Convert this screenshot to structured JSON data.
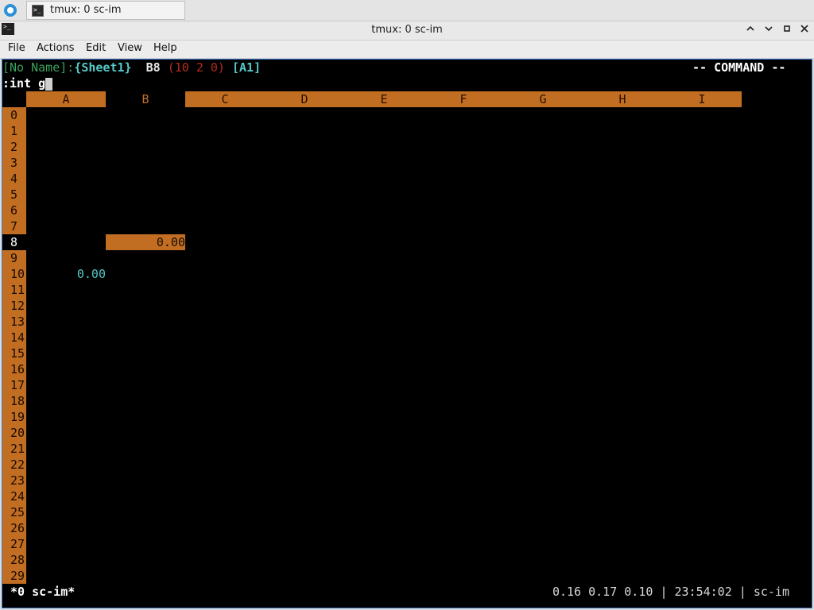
{
  "taskbar": {
    "task_label": "tmux: 0 sc-im"
  },
  "window": {
    "title": "tmux: 0 sc-im",
    "minimize": "^",
    "restore": "⌄",
    "maximize": "□",
    "close": "✕"
  },
  "menubar": {
    "items": [
      "File",
      "Actions",
      "Edit",
      "View",
      "Help"
    ]
  },
  "scim": {
    "header": {
      "file": "[No Name]",
      "colon": ":",
      "sheet": "{Sheet1}",
      "cell": "B8",
      "cell_info": "(10 2 0)",
      "cell_ref": "[A1]",
      "mode": "-- COMMAND --"
    },
    "command_line": ":int g",
    "columns": [
      "A",
      "B",
      "C",
      "D",
      "E",
      "F",
      "G",
      "H",
      "I"
    ],
    "rows": [
      "0",
      "1",
      "2",
      "3",
      "4",
      "5",
      "6",
      "7",
      "8",
      "9",
      "10",
      "11",
      "12",
      "13",
      "14",
      "15",
      "16",
      "17",
      "18",
      "19",
      "20",
      "21",
      "22",
      "23",
      "24",
      "25",
      "26",
      "27",
      "28",
      "29"
    ],
    "cells": {
      "b8": "0.00",
      "a10": "0.00"
    },
    "selected_row": "8",
    "selected_col": "B"
  },
  "tmux": {
    "window_label": "*0 sc-im*",
    "load": "0.16 0.17 0.10",
    "sep1": "|",
    "time": "23:54:02",
    "sep2": "|",
    "host": "sc-im"
  },
  "colors": {
    "accent_orange": "#c16e22",
    "green": "#3aa15c",
    "cyan": "#56c8c8",
    "red": "#b52a1e"
  }
}
